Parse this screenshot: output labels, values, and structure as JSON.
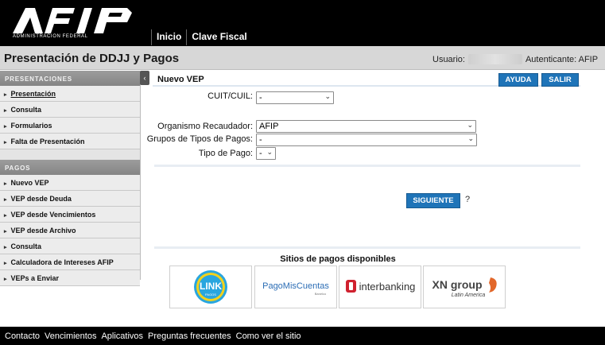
{
  "brand": {
    "logo_text": "AFIP",
    "subtitle": "ADMINISTRACION FEDERAL"
  },
  "topnav": [
    "Inicio",
    "Clave Fiscal"
  ],
  "title_bar": {
    "title": "Presentación de DDJJ y Pagos",
    "user_label": "Usuario:",
    "auth_label": "Autenticante: AFIP"
  },
  "sidebar": {
    "collapse_glyph": "‹",
    "presentaciones": {
      "header": "PRESENTACIONES",
      "items": [
        "Presentación",
        "Consulta",
        "Formularios",
        "Falta de Presentación"
      ]
    },
    "pagos": {
      "header": "PAGOS",
      "items": [
        "Nuevo VEP",
        "VEP desde Deuda",
        "VEP desde Vencimientos",
        "VEP desde Archivo",
        "Consulta",
        "Calculadora de Intereses AFIP",
        "VEPs a Enviar"
      ]
    }
  },
  "main": {
    "title": "Nuevo VEP",
    "ayuda": "AYUDA",
    "salir": "SALIR",
    "form": {
      "cuit_label": "CUIT/CUIL:",
      "cuit_value": "-",
      "organismo_label": "Organismo Recaudador:",
      "organismo_value": "AFIP",
      "grupos_label": "Grupos de Tipos de Pagos:",
      "grupos_value": "-",
      "tipo_label": "Tipo de Pago:",
      "tipo_value": "-"
    },
    "siguiente": "SIGUIENTE",
    "help_mark": "?",
    "sitios_title": "Sitios de pagos disponibles",
    "sites": {
      "link": {
        "main": "LINK",
        "sub": "PAGOS"
      },
      "pmc": {
        "main": "PagoMisCuentas",
        "sub": "Banelco"
      },
      "interbanking": {
        "main": "interbanking"
      },
      "xn": {
        "main": "XN group",
        "sub": "Latin America"
      }
    }
  },
  "footer": [
    "Contacto",
    "Vencimientos",
    "Aplicativos",
    "Preguntas frecuentes",
    "Como ver el sitio"
  ],
  "colors": {
    "accent_blue": "#1f74b8",
    "header_black": "#000000",
    "title_gray": "#d7d7d7",
    "link_blue": "#29a6df",
    "interbanking_red": "#d0212f",
    "xn_orange": "#e2672a"
  },
  "icons": [
    "chevron-down-icon",
    "bullet-arrow-icon",
    "collapse-arrow-icon"
  ]
}
